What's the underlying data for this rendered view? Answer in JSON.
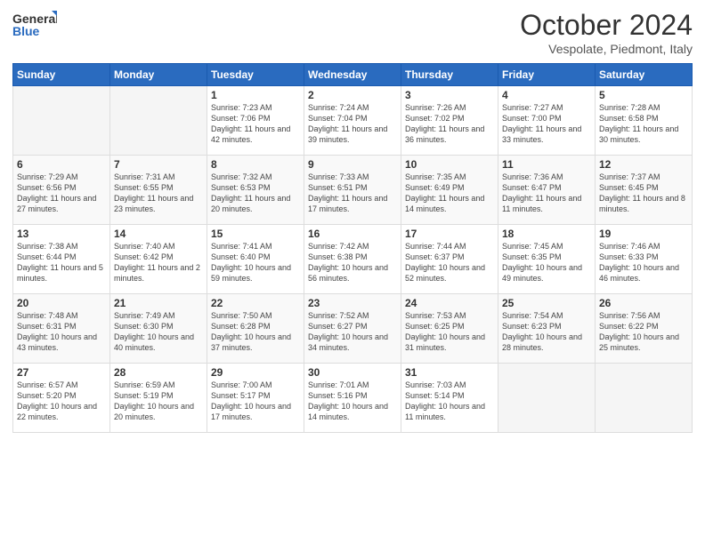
{
  "logo": {
    "line1": "General",
    "line2": "Blue"
  },
  "title": "October 2024",
  "location": "Vespolate, Piedmont, Italy",
  "weekdays": [
    "Sunday",
    "Monday",
    "Tuesday",
    "Wednesday",
    "Thursday",
    "Friday",
    "Saturday"
  ],
  "weeks": [
    [
      {
        "day": "",
        "info": ""
      },
      {
        "day": "",
        "info": ""
      },
      {
        "day": "1",
        "info": "Sunrise: 7:23 AM\nSunset: 7:06 PM\nDaylight: 11 hours and 42 minutes."
      },
      {
        "day": "2",
        "info": "Sunrise: 7:24 AM\nSunset: 7:04 PM\nDaylight: 11 hours and 39 minutes."
      },
      {
        "day": "3",
        "info": "Sunrise: 7:26 AM\nSunset: 7:02 PM\nDaylight: 11 hours and 36 minutes."
      },
      {
        "day": "4",
        "info": "Sunrise: 7:27 AM\nSunset: 7:00 PM\nDaylight: 11 hours and 33 minutes."
      },
      {
        "day": "5",
        "info": "Sunrise: 7:28 AM\nSunset: 6:58 PM\nDaylight: 11 hours and 30 minutes."
      }
    ],
    [
      {
        "day": "6",
        "info": "Sunrise: 7:29 AM\nSunset: 6:56 PM\nDaylight: 11 hours and 27 minutes."
      },
      {
        "day": "7",
        "info": "Sunrise: 7:31 AM\nSunset: 6:55 PM\nDaylight: 11 hours and 23 minutes."
      },
      {
        "day": "8",
        "info": "Sunrise: 7:32 AM\nSunset: 6:53 PM\nDaylight: 11 hours and 20 minutes."
      },
      {
        "day": "9",
        "info": "Sunrise: 7:33 AM\nSunset: 6:51 PM\nDaylight: 11 hours and 17 minutes."
      },
      {
        "day": "10",
        "info": "Sunrise: 7:35 AM\nSunset: 6:49 PM\nDaylight: 11 hours and 14 minutes."
      },
      {
        "day": "11",
        "info": "Sunrise: 7:36 AM\nSunset: 6:47 PM\nDaylight: 11 hours and 11 minutes."
      },
      {
        "day": "12",
        "info": "Sunrise: 7:37 AM\nSunset: 6:45 PM\nDaylight: 11 hours and 8 minutes."
      }
    ],
    [
      {
        "day": "13",
        "info": "Sunrise: 7:38 AM\nSunset: 6:44 PM\nDaylight: 11 hours and 5 minutes."
      },
      {
        "day": "14",
        "info": "Sunrise: 7:40 AM\nSunset: 6:42 PM\nDaylight: 11 hours and 2 minutes."
      },
      {
        "day": "15",
        "info": "Sunrise: 7:41 AM\nSunset: 6:40 PM\nDaylight: 10 hours and 59 minutes."
      },
      {
        "day": "16",
        "info": "Sunrise: 7:42 AM\nSunset: 6:38 PM\nDaylight: 10 hours and 56 minutes."
      },
      {
        "day": "17",
        "info": "Sunrise: 7:44 AM\nSunset: 6:37 PM\nDaylight: 10 hours and 52 minutes."
      },
      {
        "day": "18",
        "info": "Sunrise: 7:45 AM\nSunset: 6:35 PM\nDaylight: 10 hours and 49 minutes."
      },
      {
        "day": "19",
        "info": "Sunrise: 7:46 AM\nSunset: 6:33 PM\nDaylight: 10 hours and 46 minutes."
      }
    ],
    [
      {
        "day": "20",
        "info": "Sunrise: 7:48 AM\nSunset: 6:31 PM\nDaylight: 10 hours and 43 minutes."
      },
      {
        "day": "21",
        "info": "Sunrise: 7:49 AM\nSunset: 6:30 PM\nDaylight: 10 hours and 40 minutes."
      },
      {
        "day": "22",
        "info": "Sunrise: 7:50 AM\nSunset: 6:28 PM\nDaylight: 10 hours and 37 minutes."
      },
      {
        "day": "23",
        "info": "Sunrise: 7:52 AM\nSunset: 6:27 PM\nDaylight: 10 hours and 34 minutes."
      },
      {
        "day": "24",
        "info": "Sunrise: 7:53 AM\nSunset: 6:25 PM\nDaylight: 10 hours and 31 minutes."
      },
      {
        "day": "25",
        "info": "Sunrise: 7:54 AM\nSunset: 6:23 PM\nDaylight: 10 hours and 28 minutes."
      },
      {
        "day": "26",
        "info": "Sunrise: 7:56 AM\nSunset: 6:22 PM\nDaylight: 10 hours and 25 minutes."
      }
    ],
    [
      {
        "day": "27",
        "info": "Sunrise: 6:57 AM\nSunset: 5:20 PM\nDaylight: 10 hours and 22 minutes."
      },
      {
        "day": "28",
        "info": "Sunrise: 6:59 AM\nSunset: 5:19 PM\nDaylight: 10 hours and 20 minutes."
      },
      {
        "day": "29",
        "info": "Sunrise: 7:00 AM\nSunset: 5:17 PM\nDaylight: 10 hours and 17 minutes."
      },
      {
        "day": "30",
        "info": "Sunrise: 7:01 AM\nSunset: 5:16 PM\nDaylight: 10 hours and 14 minutes."
      },
      {
        "day": "31",
        "info": "Sunrise: 7:03 AM\nSunset: 5:14 PM\nDaylight: 10 hours and 11 minutes."
      },
      {
        "day": "",
        "info": ""
      },
      {
        "day": "",
        "info": ""
      }
    ]
  ]
}
